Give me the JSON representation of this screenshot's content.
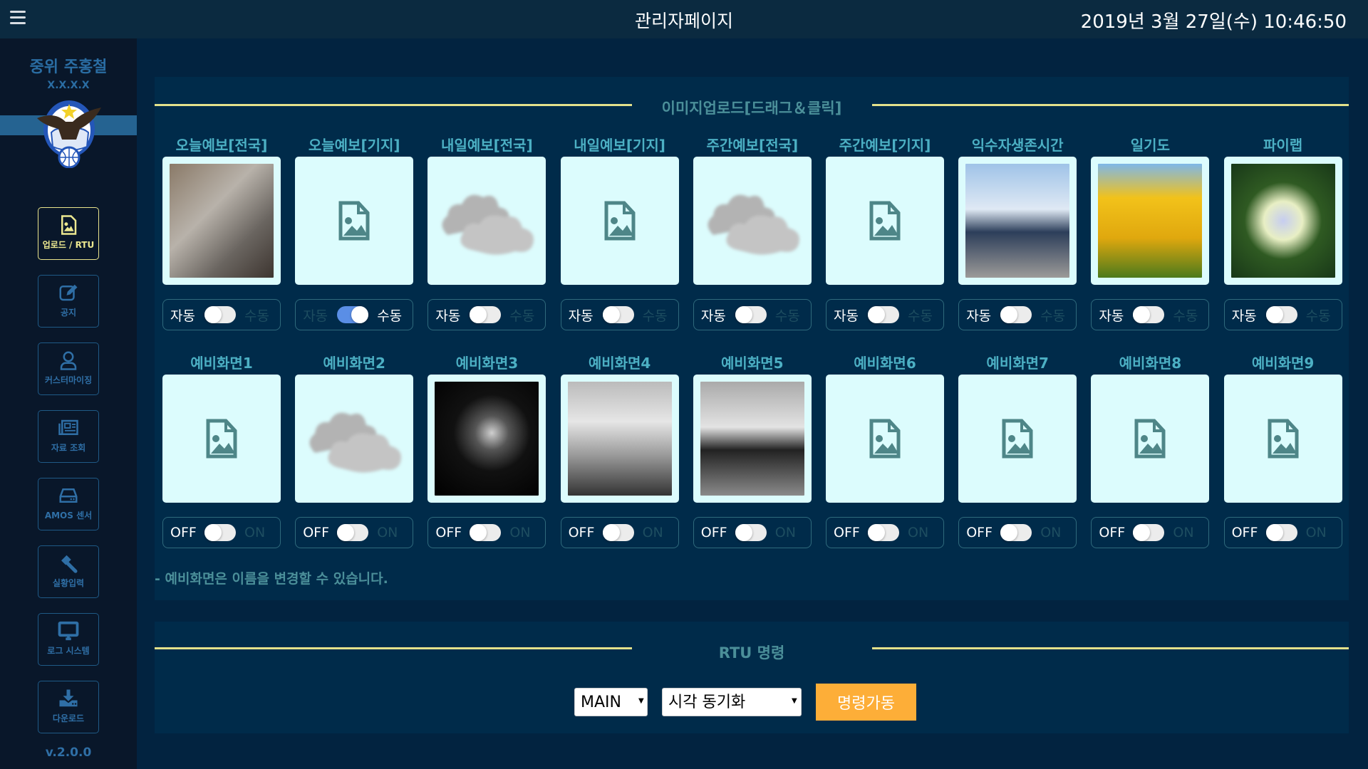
{
  "header": {
    "title": "관리자페이지",
    "datetime": "2019년 3월 27일(수) 10:46:50"
  },
  "sidebar": {
    "user_name": "중위 주홍철",
    "user_id": "X.X.X.X",
    "version": "v.2.0.0",
    "items": [
      {
        "label": "업로드 / RTU",
        "icon": "image-file-icon",
        "active": true
      },
      {
        "label": "공지",
        "icon": "edit-icon",
        "active": false
      },
      {
        "label": "커스터마이징",
        "icon": "user-icon",
        "active": false
      },
      {
        "label": "자료 조회",
        "icon": "newspaper-icon",
        "active": false
      },
      {
        "label": "AMOS 센서",
        "icon": "hard-drive-icon",
        "active": false
      },
      {
        "label": "실황입력",
        "icon": "gavel-icon",
        "active": false
      },
      {
        "label": "로그 시스템",
        "icon": "monitor-icon",
        "active": false
      },
      {
        "label": "다운로드",
        "icon": "download-icon",
        "active": false
      }
    ]
  },
  "upload": {
    "title": "이미지업로드[드래그＆클릭]",
    "note": "- 예비화면은 이름을 변경할 수 있습니다.",
    "row1": [
      {
        "label": "오늘예보[전국]",
        "image": "koala",
        "left": "자동",
        "right": "수동",
        "on": false
      },
      {
        "label": "오늘예보[기지]",
        "image": "placeholder",
        "left": "자동",
        "right": "수동",
        "on": true
      },
      {
        "label": "내일예보[전국]",
        "image": "cloud",
        "left": "자동",
        "right": "수동",
        "on": false
      },
      {
        "label": "내일예보[기지]",
        "image": "placeholder",
        "left": "자동",
        "right": "수동",
        "on": false
      },
      {
        "label": "주간예보[전국]",
        "image": "cloud",
        "left": "자동",
        "right": "수동",
        "on": false
      },
      {
        "label": "주간예보[기지]",
        "image": "placeholder",
        "left": "자동",
        "right": "수동",
        "on": false
      },
      {
        "label": "익수자생존시간",
        "image": "penguins",
        "left": "자동",
        "right": "수동",
        "on": false
      },
      {
        "label": "일기도",
        "image": "tulips",
        "left": "자동",
        "right": "수동",
        "on": false
      },
      {
        "label": "파이랩",
        "image": "hydrangea",
        "left": "자동",
        "right": "수동",
        "on": false
      }
    ],
    "row2": [
      {
        "label": "예비화면1",
        "image": "placeholder",
        "left": "OFF",
        "right": "ON",
        "on": false
      },
      {
        "label": "예비화면2",
        "image": "cloud",
        "left": "OFF",
        "right": "ON",
        "on": false
      },
      {
        "label": "예비화면3",
        "image": "jellyfish",
        "left": "OFF",
        "right": "ON",
        "on": false
      },
      {
        "label": "예비화면4",
        "image": "tulips-bw",
        "left": "OFF",
        "right": "ON",
        "on": false
      },
      {
        "label": "예비화면5",
        "image": "penguins-bw",
        "left": "OFF",
        "right": "ON",
        "on": false
      },
      {
        "label": "예비화면6",
        "image": "placeholder",
        "left": "OFF",
        "right": "ON",
        "on": false
      },
      {
        "label": "예비화면7",
        "image": "placeholder",
        "left": "OFF",
        "right": "ON",
        "on": false
      },
      {
        "label": "예비화면8",
        "image": "placeholder",
        "left": "OFF",
        "right": "ON",
        "on": false
      },
      {
        "label": "예비화면9",
        "image": "placeholder",
        "left": "OFF",
        "right": "ON",
        "on": false
      }
    ]
  },
  "rtu": {
    "title": "RTU 명령",
    "target_select": "MAIN",
    "command_select": "시각 동기화",
    "run_label": "명령가동"
  },
  "colors": {
    "accent_yellow": "#e3e18b",
    "run_button": "#fdae38",
    "toggle_on": "#5a8ee6"
  }
}
